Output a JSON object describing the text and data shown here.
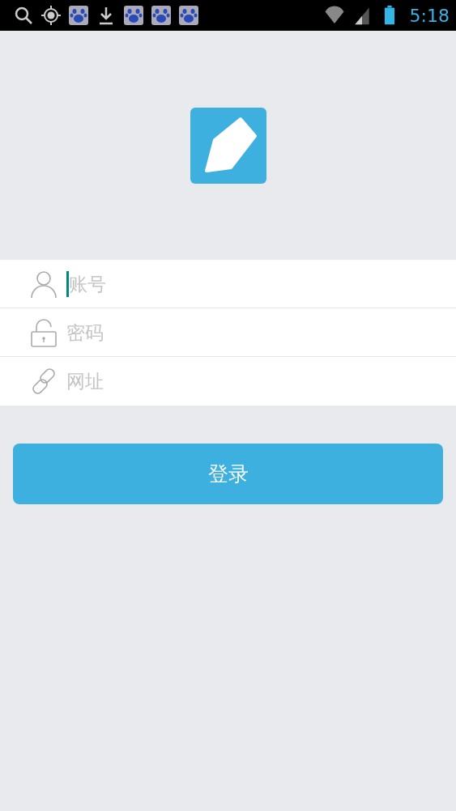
{
  "status_bar": {
    "notifications": [
      {
        "kind": "search"
      },
      {
        "kind": "gps"
      },
      {
        "kind": "baidu"
      },
      {
        "kind": "download"
      },
      {
        "kind": "baidu"
      },
      {
        "kind": "baidu"
      },
      {
        "kind": "baidu"
      }
    ],
    "time": "5:18"
  },
  "fields": [
    {
      "kind": "user",
      "placeholder": "账号",
      "focused": true
    },
    {
      "kind": "lock",
      "placeholder": "密码",
      "focused": false
    },
    {
      "kind": "link",
      "placeholder": "网址",
      "focused": false
    }
  ],
  "login_button": "登录"
}
